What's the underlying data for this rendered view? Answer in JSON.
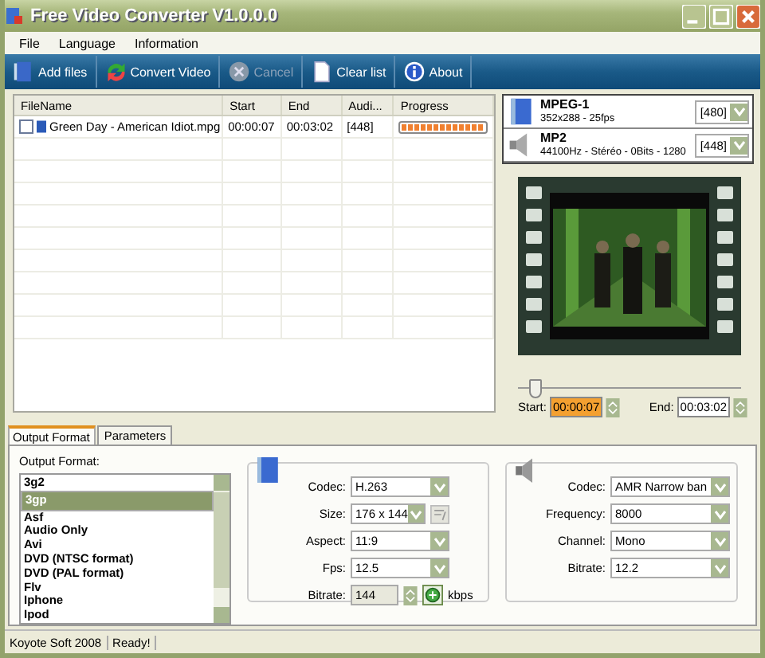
{
  "window": {
    "title": "Free Video Converter V1.0.0.0"
  },
  "menu": [
    "File",
    "Language",
    "Information"
  ],
  "toolbar": [
    {
      "kind": "add",
      "label": "Add files",
      "disabled": false
    },
    {
      "kind": "convert",
      "label": "Convert Video",
      "disabled": false
    },
    {
      "kind": "cancel",
      "label": "Cancel",
      "disabled": true
    },
    {
      "kind": "clear",
      "label": "Clear list",
      "disabled": false
    },
    {
      "kind": "about",
      "label": "About",
      "disabled": false
    }
  ],
  "table": {
    "columns": [
      "FileName",
      "Start",
      "End",
      "Audi...",
      "Progress"
    ],
    "rows": [
      {
        "checked": false,
        "filename": "Green Day - American Idiot.mpg",
        "start": "00:00:07",
        "end": "00:03:02",
        "audio": "[448]",
        "level": 1
      }
    ]
  },
  "formats": [
    {
      "kind": "video",
      "name": "MPEG-1",
      "details": "352x288 - 25fps",
      "value": "[480]"
    },
    {
      "kind": "audio",
      "name": "MP2",
      "details": "44100Hz - Stéréo - 0Bits - 1280",
      "value": "[448]"
    }
  ],
  "preview": {
    "level": 0.05,
    "start_label": "Start:",
    "start": "00:00:07",
    "end_label": "End:",
    "end": "00:03:02"
  },
  "tabs": [
    {
      "label": "Output Format",
      "selected": true
    },
    {
      "label": "Parameters",
      "selected": false
    }
  ],
  "output_format": {
    "label": "Output Format:",
    "items": [
      {
        "label": "3g2",
        "selected": false
      },
      {
        "label": "3gp",
        "selected": true
      },
      {
        "label": "Asf",
        "selected": false
      },
      {
        "label": "Audio Only",
        "selected": false
      },
      {
        "label": "Avi",
        "selected": false
      },
      {
        "label": "DVD (NTSC format)",
        "selected": false
      },
      {
        "label": "DVD (PAL format)",
        "selected": false
      },
      {
        "label": "Flv",
        "selected": false
      },
      {
        "label": "Iphone",
        "selected": false
      },
      {
        "label": "Ipod",
        "selected": false
      }
    ]
  },
  "video_settings": [
    {
      "kind": "select",
      "label": "Codec:",
      "value": "H.263"
    },
    {
      "kind": "select-edit",
      "label": "Size:",
      "value": "176 x 144"
    },
    {
      "kind": "select",
      "label": "Aspect:",
      "value": "11:9"
    },
    {
      "kind": "select",
      "label": "Fps:",
      "value": "12.5"
    },
    {
      "kind": "spin",
      "label": "Bitrate:",
      "value": "144",
      "unit": "kbps"
    }
  ],
  "audio_settings": [
    {
      "kind": "select",
      "label": "Codec:",
      "value": "AMR Narrow ban"
    },
    {
      "kind": "select",
      "label": "Frequency:",
      "value": "8000"
    },
    {
      "kind": "select",
      "label": "Channel:",
      "value": "Mono"
    },
    {
      "kind": "select",
      "label": "Bitrate:",
      "value": "12.2"
    }
  ],
  "status_bar": [
    "Koyote Soft 2008",
    "Ready!"
  ]
}
